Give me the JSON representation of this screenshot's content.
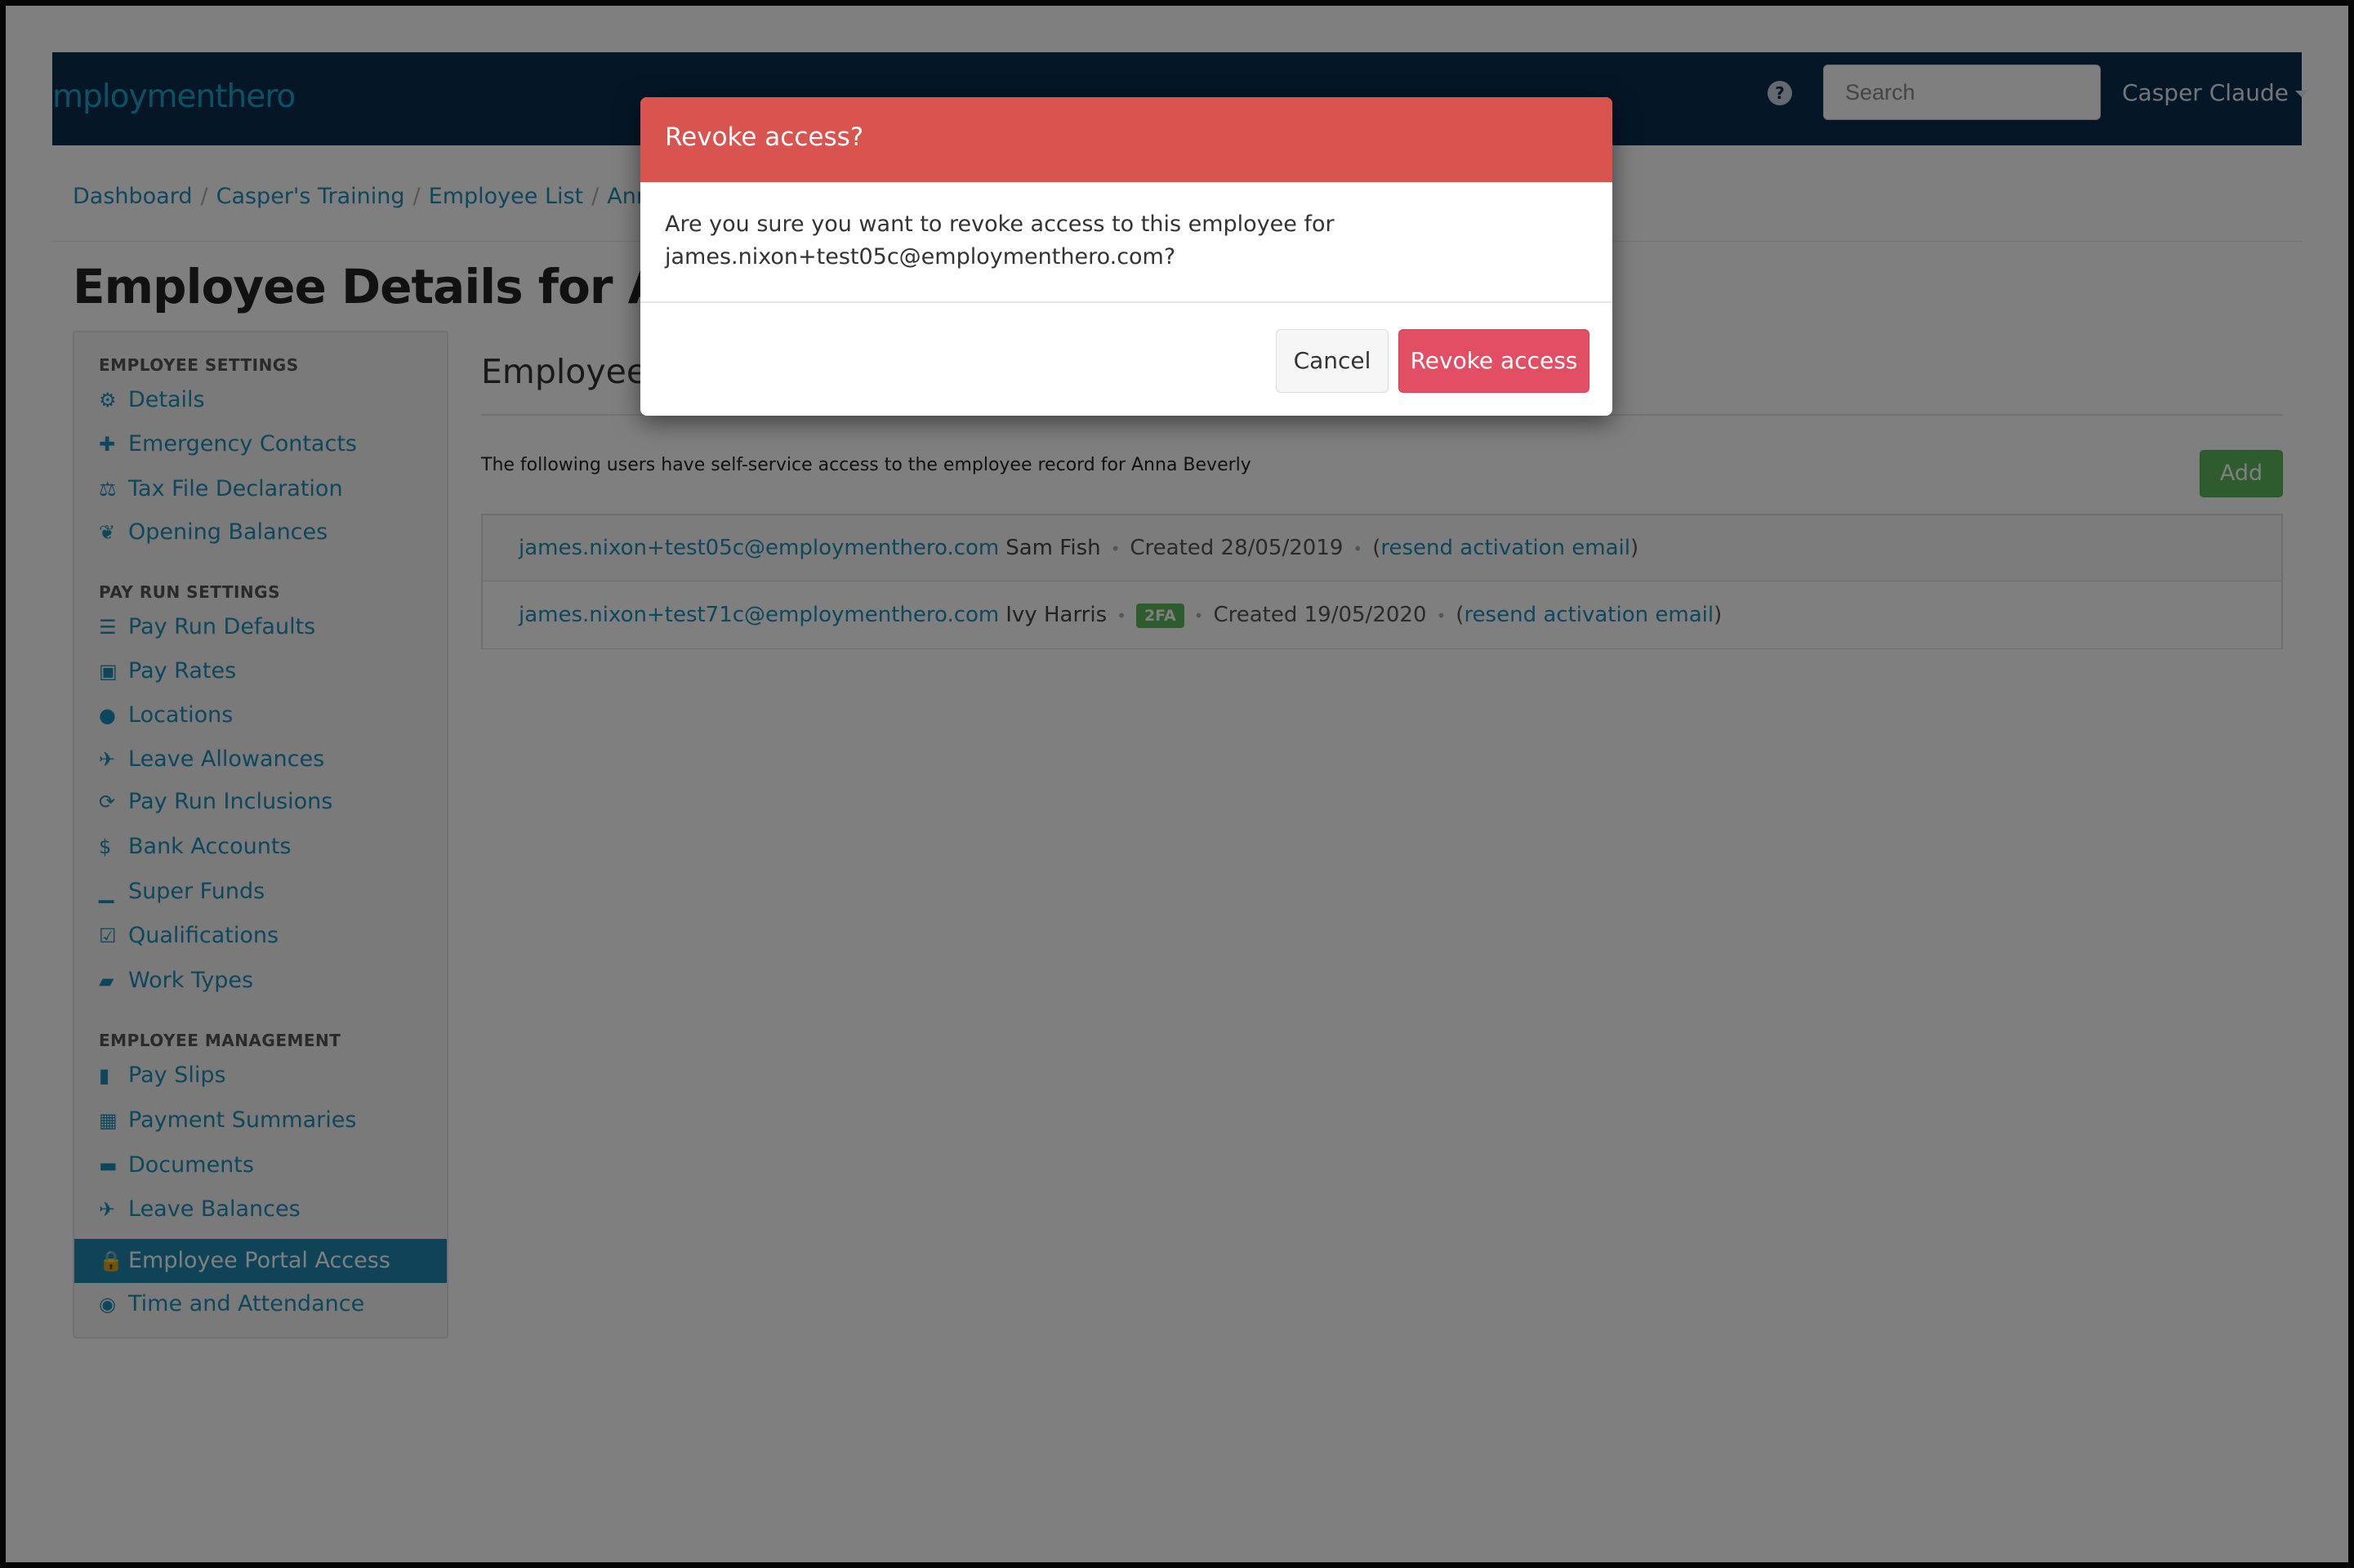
{
  "navbar": {
    "brand": "mploymenthero",
    "help_icon": "?",
    "search_placeholder": "Search",
    "user_name": "Casper Claude"
  },
  "breadcrumb": [
    "Dashboard",
    "Casper's Training",
    "Employee List",
    "Anna"
  ],
  "page_title": "Employee Details for Anna",
  "sidebar": {
    "sections": [
      {
        "title": "EMPLOYEE SETTINGS",
        "items": [
          {
            "label": "Details",
            "icon": "gear-icon",
            "glyph": "⚙"
          },
          {
            "label": "Emergency Contacts",
            "icon": "plus-icon",
            "glyph": "✚"
          },
          {
            "label": "Tax File Declaration",
            "icon": "scales-icon",
            "glyph": "⚖"
          },
          {
            "label": "Opening Balances",
            "icon": "leaf-icon",
            "glyph": "❦"
          }
        ]
      },
      {
        "title": "PAY RUN SETTINGS",
        "items": [
          {
            "label": "Pay Run Defaults",
            "icon": "list-icon",
            "glyph": "☰"
          },
          {
            "label": "Pay Rates",
            "icon": "money-icon",
            "glyph": "▣"
          },
          {
            "label": "Locations",
            "icon": "globe-icon",
            "glyph": "●"
          },
          {
            "label": "Leave Allowances",
            "icon": "plane-icon",
            "glyph": "✈"
          },
          {
            "label": "Pay Run Inclusions",
            "icon": "refresh-icon",
            "glyph": "⟳"
          },
          {
            "label": "Bank Accounts",
            "icon": "dollar-icon",
            "glyph": "$"
          },
          {
            "label": "Super Funds",
            "icon": "signal-icon",
            "glyph": "▁"
          },
          {
            "label": "Qualifications",
            "icon": "checkbox-icon",
            "glyph": "☑"
          },
          {
            "label": "Work Types",
            "icon": "book-icon",
            "glyph": "▰"
          }
        ]
      },
      {
        "title": "EMPLOYEE MANAGEMENT",
        "items": [
          {
            "label": "Pay Slips",
            "icon": "file-icon",
            "glyph": "▮"
          },
          {
            "label": "Payment Summaries",
            "icon": "calculator-icon",
            "glyph": "▦"
          },
          {
            "label": "Documents",
            "icon": "folder-icon",
            "glyph": "▬"
          },
          {
            "label": "Leave Balances",
            "icon": "plane-icon",
            "glyph": "✈"
          },
          {
            "label": "Employee Portal Access",
            "icon": "lock-icon",
            "glyph": "🔒"
          },
          {
            "label": "Time and Attendance",
            "icon": "user-circle-icon",
            "glyph": "◉"
          }
        ]
      }
    ]
  },
  "content": {
    "heading": "Employee",
    "intro": "The following users have self-service access to the employee record for Anna Beverly",
    "add_label": "Add",
    "rows": [
      {
        "email": "james.nixon+test05c@employmenthero.com",
        "name": "Sam Fish",
        "badge": "",
        "created": "Created 28/05/2019",
        "link": "resend activation email"
      },
      {
        "email": "james.nixon+test71c@employmenthero.com",
        "name": "Ivy Harris",
        "badge": "2FA",
        "created": "Created 19/05/2020",
        "link": "resend activation email"
      }
    ]
  },
  "modal": {
    "title": "Revoke access?",
    "message_line1": "Are you sure you want to revoke access to this employee for",
    "message_line2": "james.nixon+test05c@employmenthero.com?",
    "cancel_label": "Cancel",
    "confirm_label": "Revoke access"
  },
  "colors": {
    "navbar": "#0a2c4c",
    "link": "#1b8fb8",
    "modal_header": "#d9534f",
    "danger_button": "#e24e63",
    "add_button": "#5cb85c"
  }
}
